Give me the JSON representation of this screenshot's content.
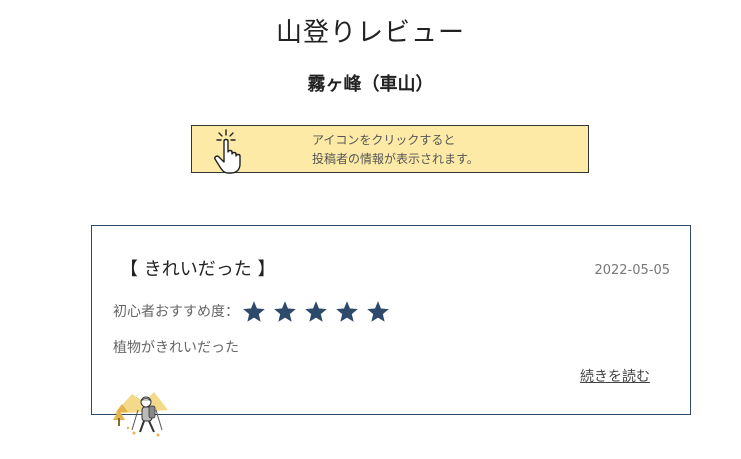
{
  "header": {
    "title": "山登りレビュー",
    "mountain": "霧ヶ峰（車山）"
  },
  "hint": {
    "line1": "アイコンをクリックすると",
    "line2": "投稿者の情報が表示されます。",
    "icon": "hand-pointer-icon"
  },
  "review": {
    "title": "【 きれいだった 】",
    "date": "2022-05-05",
    "rating_label": "初心者おすすめ度：",
    "rating": 5,
    "rating_max": 5,
    "body": "植物がきれいだった",
    "read_more": "続きを読む",
    "avatar_icon": "hiker-avatar-icon"
  },
  "colors": {
    "title_highlight": "#f7b8a8",
    "hint_background": "#fdeaa6",
    "card_border": "#2e4a6b",
    "star": "#2e4a6b"
  }
}
